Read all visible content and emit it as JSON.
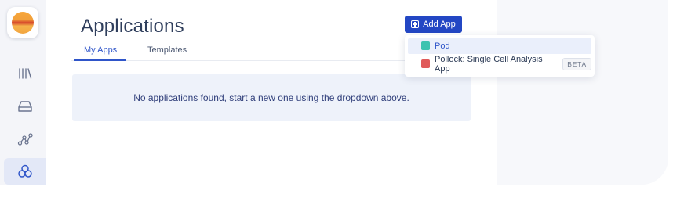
{
  "sidebar": {
    "items": [
      {
        "icon": "library-icon"
      },
      {
        "icon": "drive-icon"
      },
      {
        "icon": "workflow-icon"
      },
      {
        "icon": "apps-icon",
        "active": true
      }
    ]
  },
  "page": {
    "title": "Applications"
  },
  "tabs": [
    {
      "label": "My Apps",
      "active": true
    },
    {
      "label": "Templates",
      "active": false
    }
  ],
  "empty_state": {
    "message": "No applications found, start a new one using the dropdown above."
  },
  "toolbar": {
    "add_label": "Add App"
  },
  "dropdown": {
    "items": [
      {
        "label": "Pod",
        "icon": "pod-icon",
        "icon_color": "#3ec3b0",
        "highlighted": true
      },
      {
        "label": "Pollock: Single Cell Analysis App",
        "icon": "pollock-icon",
        "icon_color": "#e05a5a",
        "badge": "BETA"
      }
    ]
  },
  "colors": {
    "accent": "#2347c4",
    "active_tab": "#2f55c9"
  }
}
